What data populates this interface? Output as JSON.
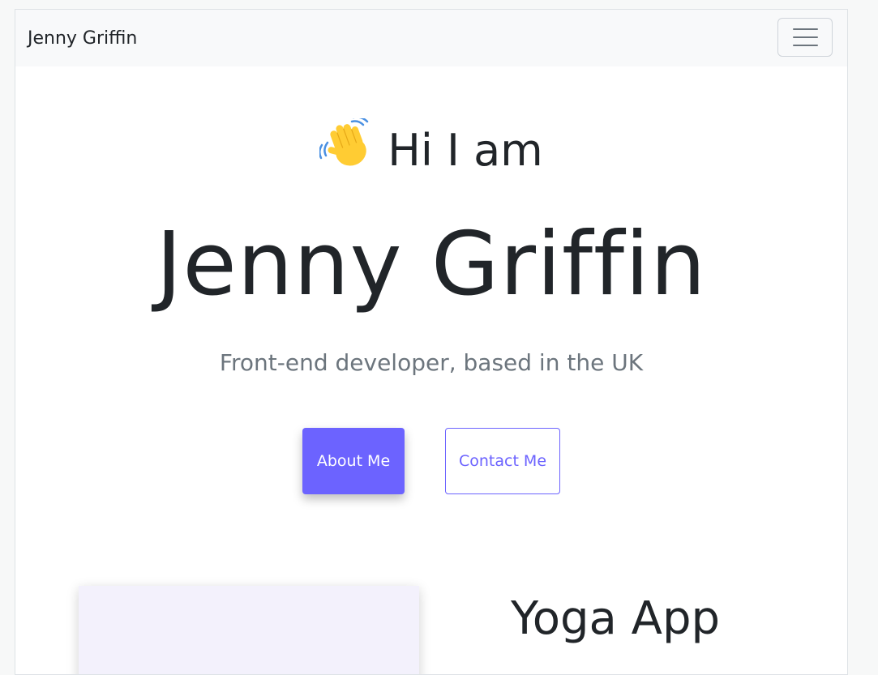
{
  "navbar": {
    "brand": "Jenny Griffin",
    "toggler_icon": "hamburger-menu-icon"
  },
  "hero": {
    "greeting": "Hi I am",
    "greeting_icon": "waving-hand-icon",
    "name": "Jenny Griffin",
    "tagline": "Front-end developer, based in the UK"
  },
  "buttons": {
    "about": "About Me",
    "contact": "Contact Me"
  },
  "project": {
    "title": "Yoga App"
  },
  "colors": {
    "accent": "#6c63ff",
    "navbar_bg": "#f8f9fa",
    "text": "#212529",
    "muted": "#6c757d",
    "card_bg": "#f3f1fc"
  }
}
